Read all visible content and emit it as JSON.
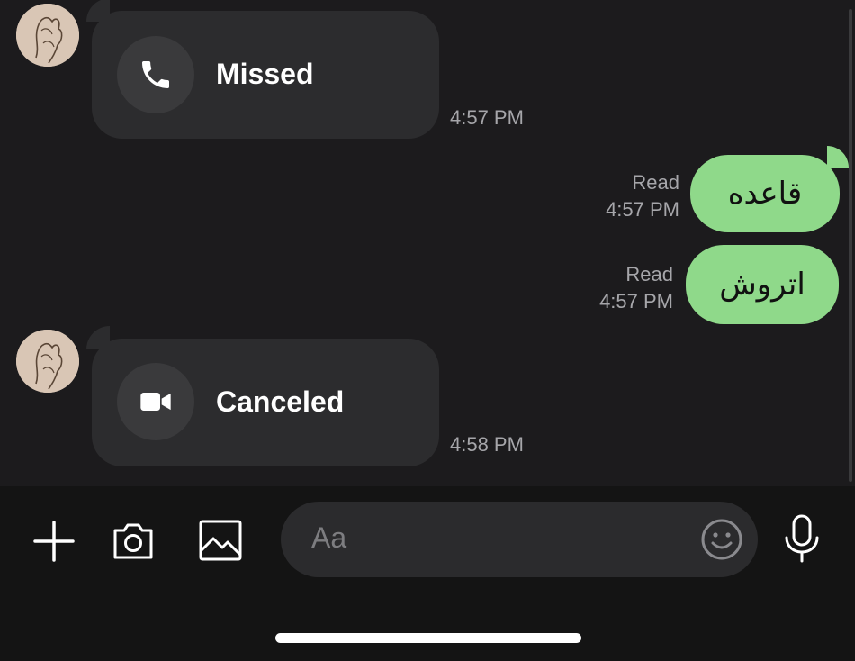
{
  "messages": [
    {
      "type": "call",
      "call_kind": "voice",
      "icon": "phone-icon",
      "label": "Missed",
      "time": "4:57 PM"
    },
    {
      "type": "text",
      "direction": "outgoing",
      "text": "قاعده",
      "status": "Read",
      "time": "4:57 PM"
    },
    {
      "type": "text",
      "direction": "outgoing",
      "text": "اتروش",
      "status": "Read",
      "time": "4:57 PM"
    },
    {
      "type": "call",
      "call_kind": "video",
      "icon": "video-camera-icon",
      "label": "Canceled",
      "time": "4:58 PM"
    }
  ],
  "composer": {
    "placeholder": "Aa",
    "tools": [
      "plus-icon",
      "camera-icon",
      "image-icon"
    ],
    "trailing": [
      "emoji-icon",
      "microphone-icon"
    ]
  },
  "colors": {
    "background": "#1c1b1d",
    "incoming_bubble": "#2c2c2e",
    "outgoing_bubble": "#8fd98a",
    "meta_text": "#a6a6aa"
  }
}
